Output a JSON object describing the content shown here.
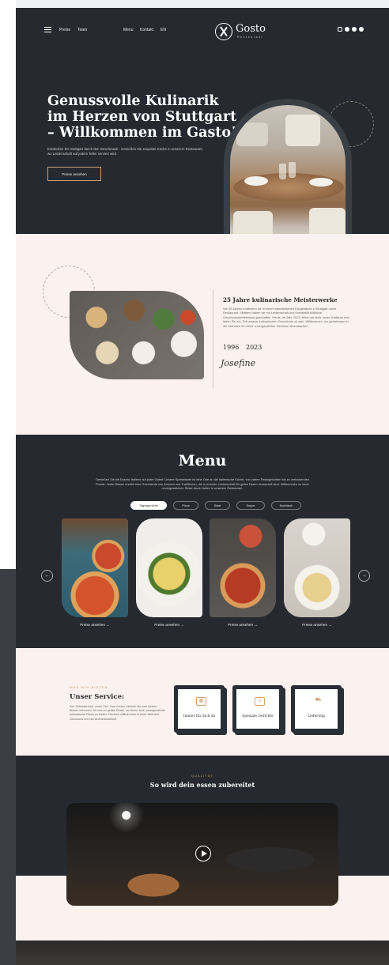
{
  "nav": {
    "links_left": [
      "Preise",
      "Team"
    ],
    "links_center": [
      "Menu",
      "Kontakt",
      "EN"
    ],
    "logo_text": "Gosto",
    "logo_sub": "Restaurant",
    "social_icons": [
      "instagram-icon",
      "facebook-icon",
      "twitter-icon",
      "pinterest-icon"
    ]
  },
  "hero": {
    "title": "Genussvolle Kulinarik im Herzen von Stuttgart – Willkommen im Gasto!",
    "text": "Entdecken Sie Stuttgart durch den Geschmack - Genießen Sie exquisite Küche in unserem Restaurant, wo Leidenschaft auf jedem Teller serviert wird.",
    "button": "Preise ansehen"
  },
  "about": {
    "title": "25 Jahre kulinarische Meisterwerke",
    "text": "Vor 25 Jahren eröffneten wir in einem bescheidenen Eckgebäude in Stuttgart unser Restaurant. Seitdem haben wir mit Leidenschaft und Kreativität köstliche Geschmackserlebnisse geschaffen. Heute, im Jahr 2023, feiern wir stolz unser Jubiläum und laden Sie ein, Teil unserer kulinarischen Geschichte zu sein. Willkommen, um gemeinsam in die nächsten 25 Jahre unvergesslicher Genüsse einzutauchen.",
    "year_start": "1996",
    "year_end": "2023",
    "signature": "Josefine"
  },
  "menu": {
    "title": "Menu",
    "text": "Genießen Sie die Essenz Italiens auf jeder Gabel: Unsere Speisekarte ist eine Ode an die italienische Küche, von zarten Pastagerichten bis zu verlockenden Pizzas. Jeder Bissen erzählt eine Geschichte von Aromen und Traditionen, die in unserer Leidenschaft für gutes Essen verwurzelt sind. Willkommen zu einer unvergesslichen Reise durch Italien in unserem Restaurant.",
    "tabs": [
      "Tagesgerichte",
      "Pizza",
      "Salat",
      "Soupe",
      "Nachtisch"
    ],
    "active_tab": "Tagesgerichte",
    "card_link": "Preise ansehen →",
    "prev_arrow": "←",
    "next_arrow": "→"
  },
  "service": {
    "kicker": "WAS WIR BIETEN",
    "title": "Unser Service:",
    "text": "Ihre Zufriedenheit, unser Ziel: Vom ersten Lächeln bis zum letzten Bissen kümmern wir uns um jedes Detail, um Ihnen eine unvergessliche kulinarische Reise zu bieten. Herzlich willkommen in einer Welt des Genusses und der Aufmerksamkeit.",
    "cards": [
      {
        "label": "Immer für dich da",
        "icon": "calendar-icon"
      },
      {
        "label": "Speziale Gerichte",
        "icon": "menu-card-icon"
      },
      {
        "label": "Lieferung",
        "icon": "delivery-truck-icon"
      }
    ]
  },
  "quality": {
    "kicker": "QUALITÄT",
    "title": "So wird dein essen zubereitet"
  },
  "colors": {
    "dark": "#262a30",
    "cream": "#fbf1ee",
    "accent": "#c59a6d"
  }
}
